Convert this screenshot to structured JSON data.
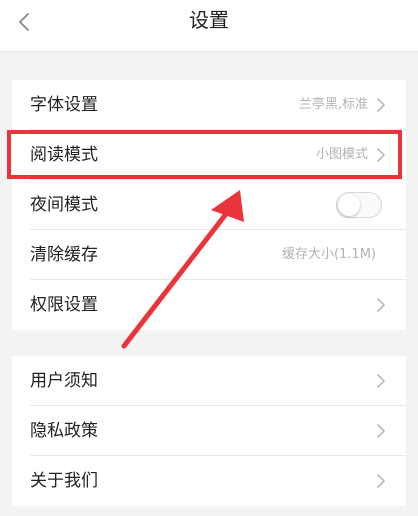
{
  "header": {
    "title": "设置"
  },
  "settings": {
    "font": {
      "label": "字体设置",
      "value": "兰亭黑,标准"
    },
    "reading_mode": {
      "label": "阅读模式",
      "value": "小图模式"
    },
    "night_mode": {
      "label": "夜间模式",
      "enabled": false
    },
    "clear_cache": {
      "label": "清除缓存",
      "value": "缓存大小(1.1M)"
    },
    "permissions": {
      "label": "权限设置"
    }
  },
  "about": {
    "user_notice": {
      "label": "用户须知"
    },
    "privacy_policy": {
      "label": "隐私政策"
    },
    "about_us": {
      "label": "关于我们"
    }
  },
  "colors": {
    "annotation_red": "#e8343a",
    "secondary_text": "#b3b3b3",
    "background": "#f3f3f3"
  }
}
